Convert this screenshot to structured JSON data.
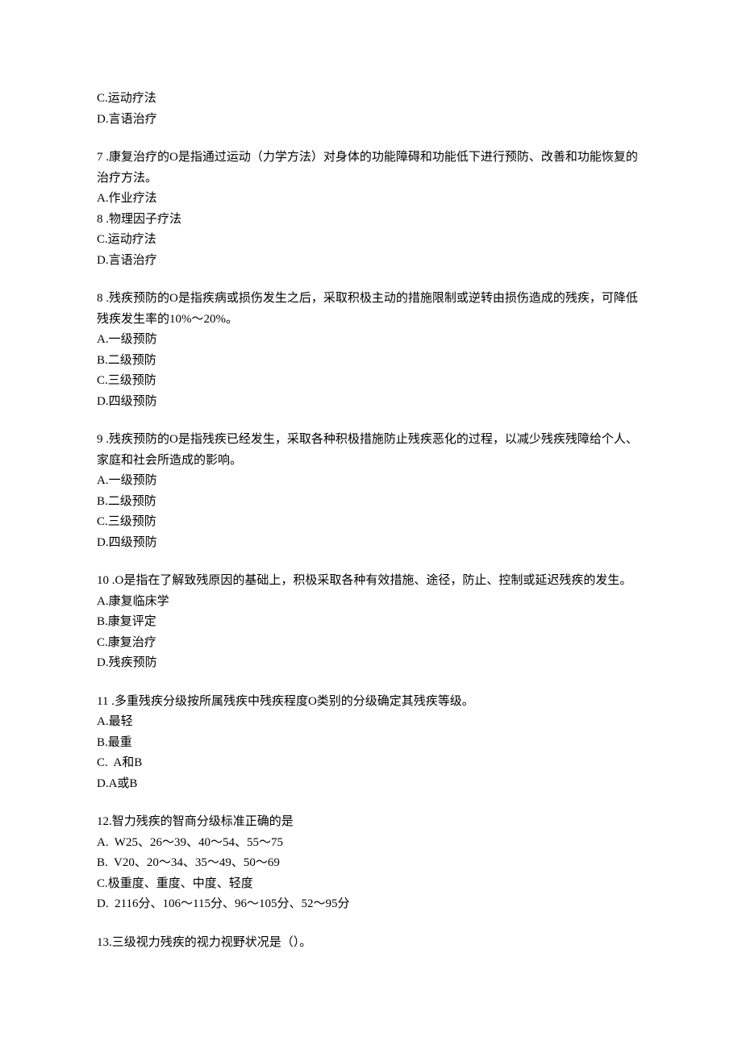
{
  "lines": {
    "q6_c": "C.运动疗法",
    "q6_d": "D.言语治疗",
    "q7_stem": "7 .康复治疗的O是指通过运动（力学方法）对身体的功能障碍和功能低下进行预防、改善和功能恢复的治疗方法。",
    "q7_a": "A.作业疗法",
    "q7_b": "8 .物理因子疗法",
    "q7_c": "C.运动疗法",
    "q7_d": "D.言语治疗",
    "q8_stem": "8 .残疾预防的O是指疾病或损伤发生之后，采取积极主动的措施限制或逆转由损伤造成的残疾，可降低残疾发生率的10%〜20%。",
    "q8_a": "A.一级预防",
    "q8_b": "B.二级预防",
    "q8_c": "C.三级预防",
    "q8_d": "D.四级预防",
    "q9_stem": "9 .残疾预防的O是指残疾已经发生，采取各种积极措施防止残疾恶化的过程，以减少残疾残障给个人、家庭和社会所造成的影响。",
    "q9_a": "A.一级预防",
    "q9_b": "B.二级预防",
    "q9_c": "C.三级预防",
    "q9_d": "D.四级预防",
    "q10_stem": "10 .O是指在了解致残原因的基础上，积极采取各种有效措施、途径，防止、控制或延迟残疾的发生。",
    "q10_a": "A.康复临床学",
    "q10_b": "B.康复评定",
    "q10_c": "C.康复治疗",
    "q10_d": "D.残疾预防",
    "q11_stem": "11 .多重残疾分级按所属残疾中残疾程度O类别的分级确定其残疾等级。",
    "q11_a": "A.最轻",
    "q11_b": "B.最重",
    "q11_c": "C.  A和B",
    "q11_d": "D.A或B",
    "q12_stem": "12.智力残疾的智商分级标准正确的是",
    "q12_a": "A.  W25、26〜39、40〜54、55〜75",
    "q12_b": "B.  V20、20〜34、35〜49、50〜69",
    "q12_c": "C.极重度、重度、中度、轻度",
    "q12_d": "D.  2116分、106〜115分、96〜105分、52〜95分",
    "q13_stem": "13.三级视力残疾的视力视野状况是（）。"
  }
}
